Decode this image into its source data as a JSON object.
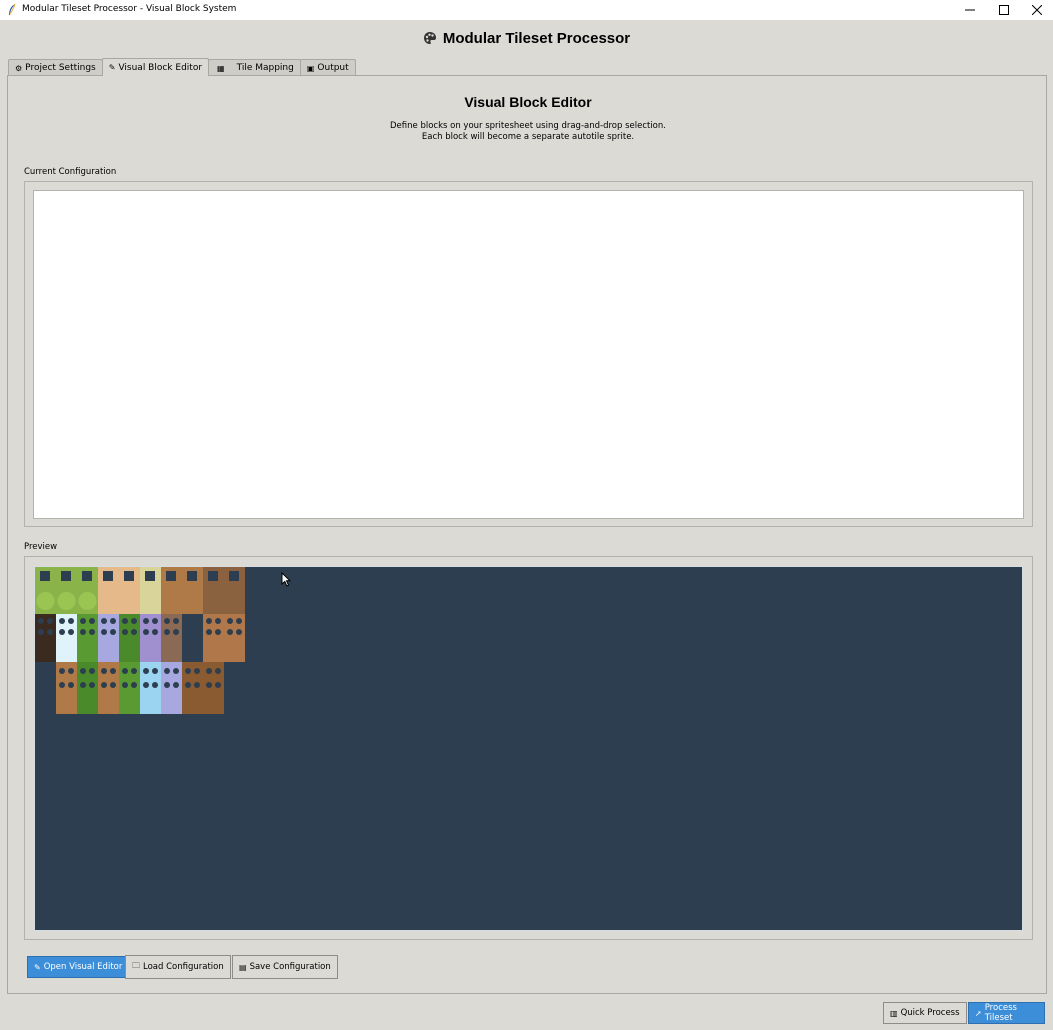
{
  "window": {
    "title": "Modular Tileset Processor - Visual Block System"
  },
  "app": {
    "title": "Modular Tileset Processor"
  },
  "tabs": [
    {
      "label": "Project Settings",
      "icon": "gear-icon",
      "active": false
    },
    {
      "label": "Visual Block Editor",
      "icon": "paint-icon",
      "active": true
    },
    {
      "label": "Tile Mapping",
      "icon": "map-icon",
      "active": false
    },
    {
      "label": "Output",
      "icon": "package-icon",
      "active": false
    }
  ],
  "editor": {
    "title": "Visual Block Editor",
    "desc_line1": "Define blocks on your spritesheet using drag-and-drop selection.",
    "desc_line2": "Each block will become a separate autotile sprite.",
    "config_label": "Current Configuration",
    "config_text": "",
    "preview_label": "Preview"
  },
  "buttons": {
    "open_visual_editor": "Open Visual Editor",
    "load_configuration": "Load Configuration",
    "save_configuration": "Save Configuration",
    "quick_process": "Quick Process",
    "process_tileset": "Process Tileset"
  },
  "colors": {
    "preview_bg": "#2c3e50",
    "primary_button": "#3d8ed8",
    "window_bg": "#dcdad5"
  }
}
